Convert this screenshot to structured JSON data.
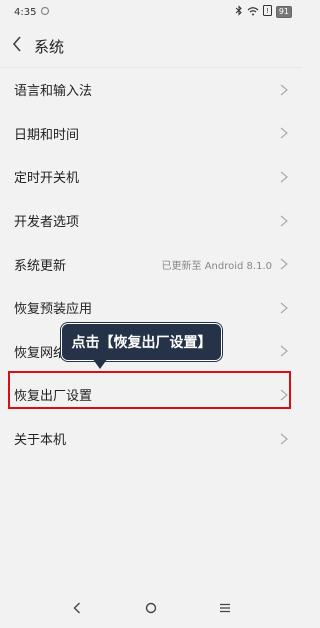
{
  "status_bar": {
    "time": "4:35",
    "battery": "91",
    "icons": [
      "notification-icon",
      "bluetooth-icon",
      "wifi-icon",
      "sim-icon",
      "battery-icon"
    ]
  },
  "header": {
    "title": "系统",
    "back_icon": "chevron-left-icon"
  },
  "settings": {
    "items": [
      {
        "label": "语言和输入法"
      },
      {
        "label": "日期和时间"
      },
      {
        "label": "定时开关机"
      },
      {
        "label": "开发者选项"
      },
      {
        "label": "系统更新",
        "value": "已更新至 Android 8.1.0"
      },
      {
        "label": "恢复预装应用"
      },
      {
        "label": "恢复网络设置"
      },
      {
        "label": "恢复出厂设置"
      },
      {
        "label": "关于本机"
      }
    ]
  },
  "annotation": {
    "callout_text": "点击【恢复出厂设置】",
    "highlight_color": "#d50f12",
    "callout_bg": "#253247"
  },
  "nav_bar": {
    "icons": [
      "back-icon",
      "home-icon",
      "menu-icon"
    ]
  }
}
